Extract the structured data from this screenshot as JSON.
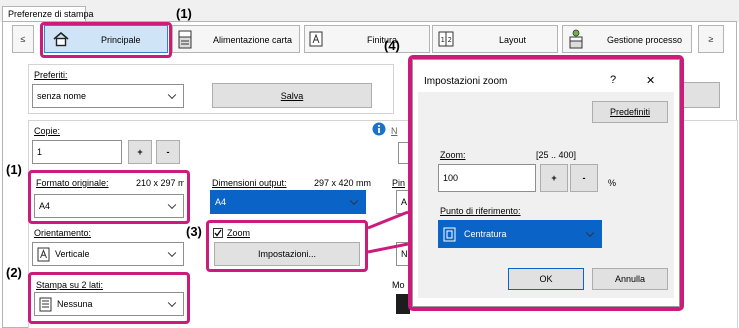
{
  "window": {
    "title": "Preferenze di stampa"
  },
  "tabs": {
    "prev": "≤",
    "next": "≥",
    "items": [
      {
        "label": "Principale"
      },
      {
        "label": "Alimentazione carta"
      },
      {
        "label": "Finitura"
      },
      {
        "label": "Layout"
      },
      {
        "label": "Gestione processo"
      }
    ]
  },
  "preferiti": {
    "label": "Preferiti:",
    "value": "senza nome",
    "save": "Salva"
  },
  "copie": {
    "label": "Copie:",
    "value": "1",
    "plus": "+",
    "minus": "-"
  },
  "formato_originale": {
    "label": "Formato originale:",
    "dims": "210 x 297 mm",
    "value": "A4"
  },
  "dimensioni_output": {
    "label": "Dimensioni output:",
    "dims": "297 x 420 mm",
    "value": "A4"
  },
  "orientamento": {
    "label": "Orientamento:",
    "value": "Verticale"
  },
  "stampa_2_lati": {
    "label": "Stampa su 2 lati:",
    "value": "Nessuna"
  },
  "zoom": {
    "label": "Zoom",
    "checked": true,
    "settings": "Impostazioni..."
  },
  "right_partial": {
    "n": "N",
    "pin": "Pin",
    "a": "A",
    "ne": "Ne",
    "mo": "Mo"
  },
  "dialog": {
    "title": "Impostazioni zoom",
    "help": "?",
    "close": "✕",
    "defaults": "Predefiniti",
    "zoom_label": "Zoom:",
    "range": "[25 .. 400]",
    "value": "100",
    "plus": "+",
    "minus": "-",
    "unit": "%",
    "ref_label": "Punto di riferimento:",
    "ref_value": "Centratura",
    "ok": "OK",
    "cancel": "Annulla"
  },
  "callouts": {
    "c1": "(1)",
    "c1b": "(1)",
    "c2": "(2)",
    "c3": "(3)",
    "c4": "(4)"
  },
  "colors": {
    "highlight": "#cc1b7a",
    "accent": "#0a64c8"
  }
}
